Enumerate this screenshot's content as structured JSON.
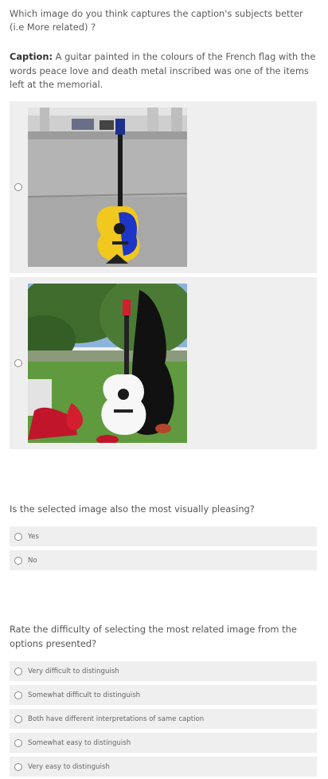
{
  "question1": {
    "text": "Which image do you think captures the caption's subjects better (i.e More related) ?"
  },
  "caption": {
    "label": "Caption:",
    "text": "A guitar painted in the colours of the French flag with the words peace love and death metal inscribed was one of the items left at the memorial."
  },
  "image_options": [
    {
      "description": "Guitar painted in yellow and blue propped on a stand on a paved plaza"
    },
    {
      "description": "White and black acoustic guitar with red headstock among flowers on grass"
    }
  ],
  "question2": {
    "text": "Is the selected image also the most visually pleasing?",
    "options": [
      "Yes",
      "No"
    ]
  },
  "question3": {
    "text": "Rate the difficulty of selecting the most related image from the options presented?",
    "options": [
      "Very difficult to distinguish",
      "Somewhat difficult to distinguish",
      "Both have different interpretations of same caption",
      "Somewhat easy to distinguish",
      "Very easy to distinguish"
    ]
  }
}
